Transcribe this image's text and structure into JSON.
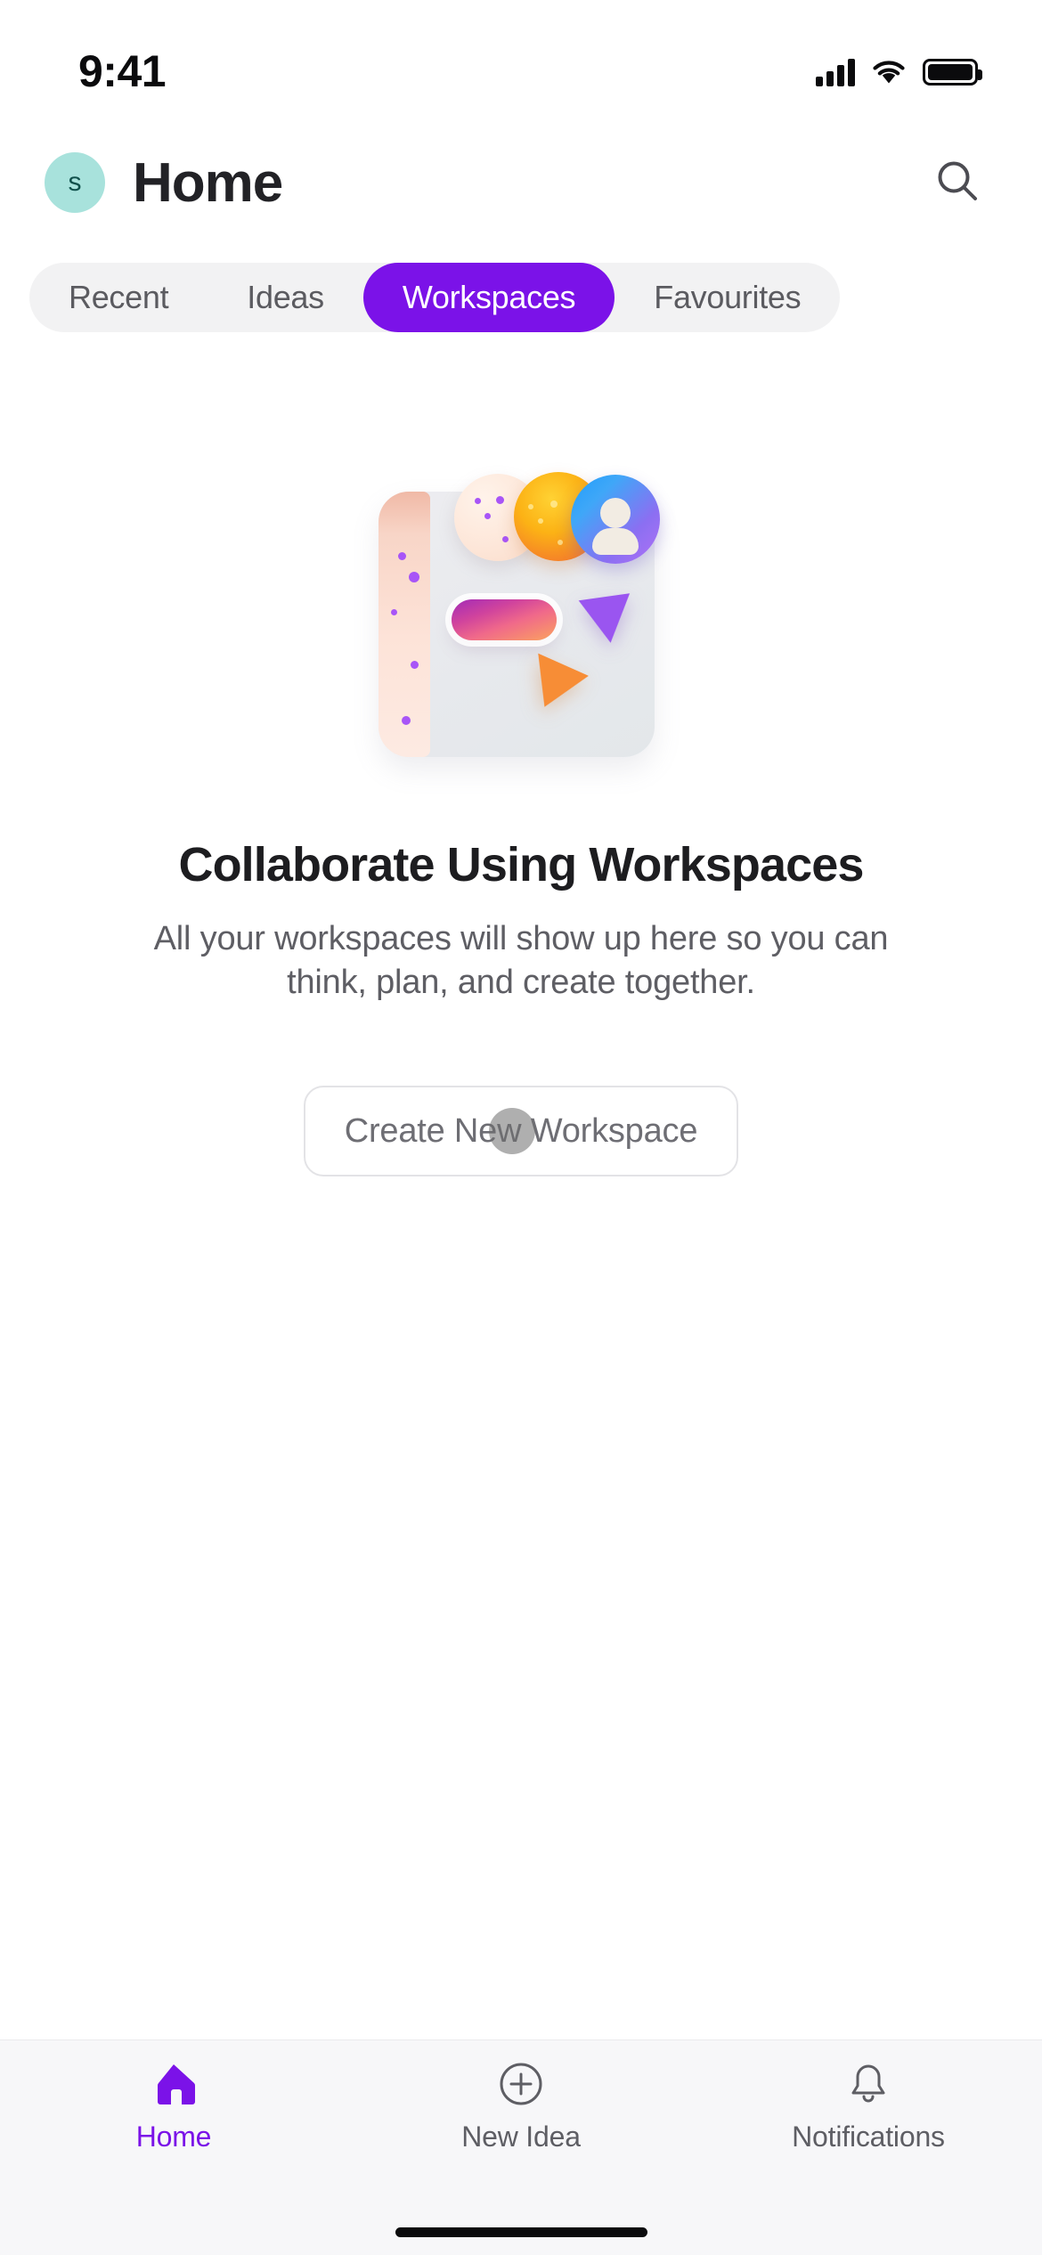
{
  "status_bar": {
    "time": "9:41",
    "cellular_icon": "cellular-signal-icon",
    "wifi_icon": "wifi-icon",
    "battery_icon": "battery-full-icon"
  },
  "header": {
    "avatar_initial": "s",
    "avatar_color": "#a8e2dc",
    "title": "Home",
    "search_icon": "search-icon"
  },
  "tabs": {
    "items": [
      {
        "label": "Recent",
        "active": false
      },
      {
        "label": "Ideas",
        "active": false
      },
      {
        "label": "Workspaces",
        "active": true
      },
      {
        "label": "Favourites",
        "active": false
      }
    ],
    "active_index": 2,
    "active_color": "#7b12e8",
    "track_color": "#f2f2f3"
  },
  "empty_state": {
    "illustration": "workspaces-collaboration-illustration",
    "title": "Collaborate Using Workspaces",
    "description": "All your workspaces will show up here so you can think, plan, and create together.",
    "cta_label": "Create New Workspace",
    "tap_indicator": "touch-point-indicator"
  },
  "bottom_nav": {
    "items": [
      {
        "label": "Home",
        "icon": "home-icon",
        "active": true
      },
      {
        "label": "New Idea",
        "icon": "plus-circle-icon",
        "active": false
      },
      {
        "label": "Notifications",
        "icon": "bell-icon",
        "active": false
      }
    ],
    "active_color": "#7b12e8",
    "inactive_color": "#5e5e64",
    "background": "#f7f7f9"
  },
  "home_indicator": "home-indicator-bar"
}
